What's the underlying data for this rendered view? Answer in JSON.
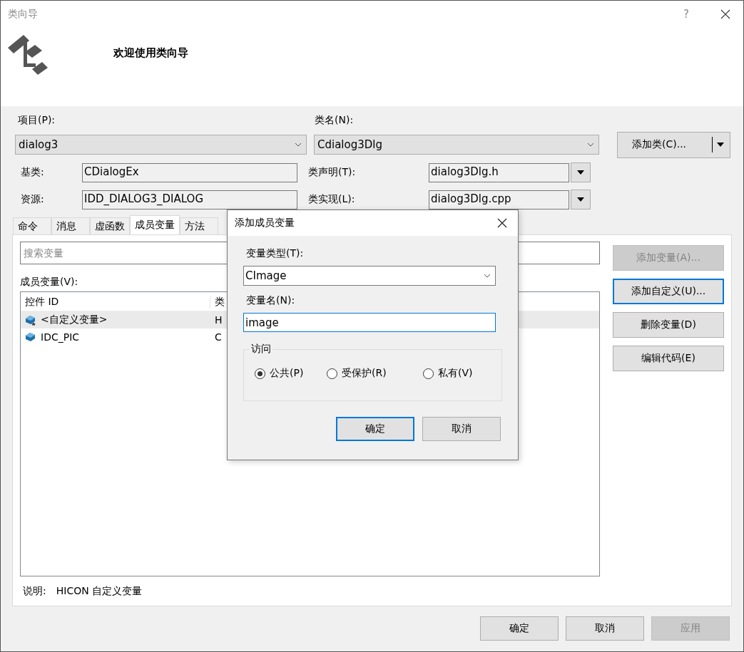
{
  "window": {
    "title": "类向导",
    "help": "?"
  },
  "header": {
    "welcome": "欢迎使用类向导"
  },
  "project": {
    "label": "项目(P):",
    "value": "dialog3"
  },
  "class_name": {
    "label": "类名(N):",
    "value": "Cdialog3Dlg"
  },
  "add_class_button": {
    "label": "添加类(C)..."
  },
  "base_class": {
    "label": "基类:",
    "value": "CDialogEx"
  },
  "resource": {
    "label": "资源:",
    "value": "IDD_DIALOG3_DIALOG"
  },
  "class_declaration": {
    "label": "类声明(T):",
    "value": "dialog3Dlg.h"
  },
  "class_implementation": {
    "label": "类实现(L):",
    "value": "dialog3Dlg.cpp"
  },
  "tabs": [
    {
      "label": "命令",
      "selected": false
    },
    {
      "label": "消息",
      "selected": false
    },
    {
      "label": "虚函数",
      "selected": false
    },
    {
      "label": "成员变量",
      "selected": true
    },
    {
      "label": "方法",
      "selected": false
    }
  ],
  "search": {
    "placeholder": "搜索变量"
  },
  "member_list": {
    "label": "成员变量(V):",
    "columns": [
      "控件 ID",
      "类"
    ],
    "rows": [
      {
        "kind": "custom",
        "cells": [
          "<自定义变量>",
          "H"
        ],
        "selected": true
      },
      {
        "kind": "control",
        "cells": [
          "IDC_PIC",
          "C"
        ],
        "selected": false
      }
    ]
  },
  "side_buttons": [
    {
      "label": "添加变量(A)...",
      "disabled": true,
      "focused": false
    },
    {
      "label": "添加自定义(U)...",
      "disabled": false,
      "focused": true
    },
    {
      "label": "删除变量(D)",
      "disabled": false,
      "focused": false
    },
    {
      "label": "编辑代码(E)",
      "disabled": false,
      "focused": false
    }
  ],
  "description": {
    "label": "说明:",
    "value": "HICON 自定义变量"
  },
  "buttons": [
    {
      "label": "确定",
      "disabled": false
    },
    {
      "label": "取消",
      "disabled": false
    },
    {
      "label": "应用",
      "disabled": true
    }
  ],
  "modal": {
    "title": "添加成员变量",
    "type": {
      "label": "变量类型(T):",
      "value": "CImage"
    },
    "name": {
      "label": "变量名(N):",
      "value": "image"
    },
    "access": {
      "label": "访问",
      "options": [
        {
          "label": "公共(P)",
          "selected": true
        },
        {
          "label": "受保护(R)",
          "selected": false
        },
        {
          "label": "私有(V)",
          "selected": false
        }
      ]
    },
    "buttons": [
      {
        "label": "确定",
        "default": true
      },
      {
        "label": "取消",
        "default": false
      }
    ]
  }
}
